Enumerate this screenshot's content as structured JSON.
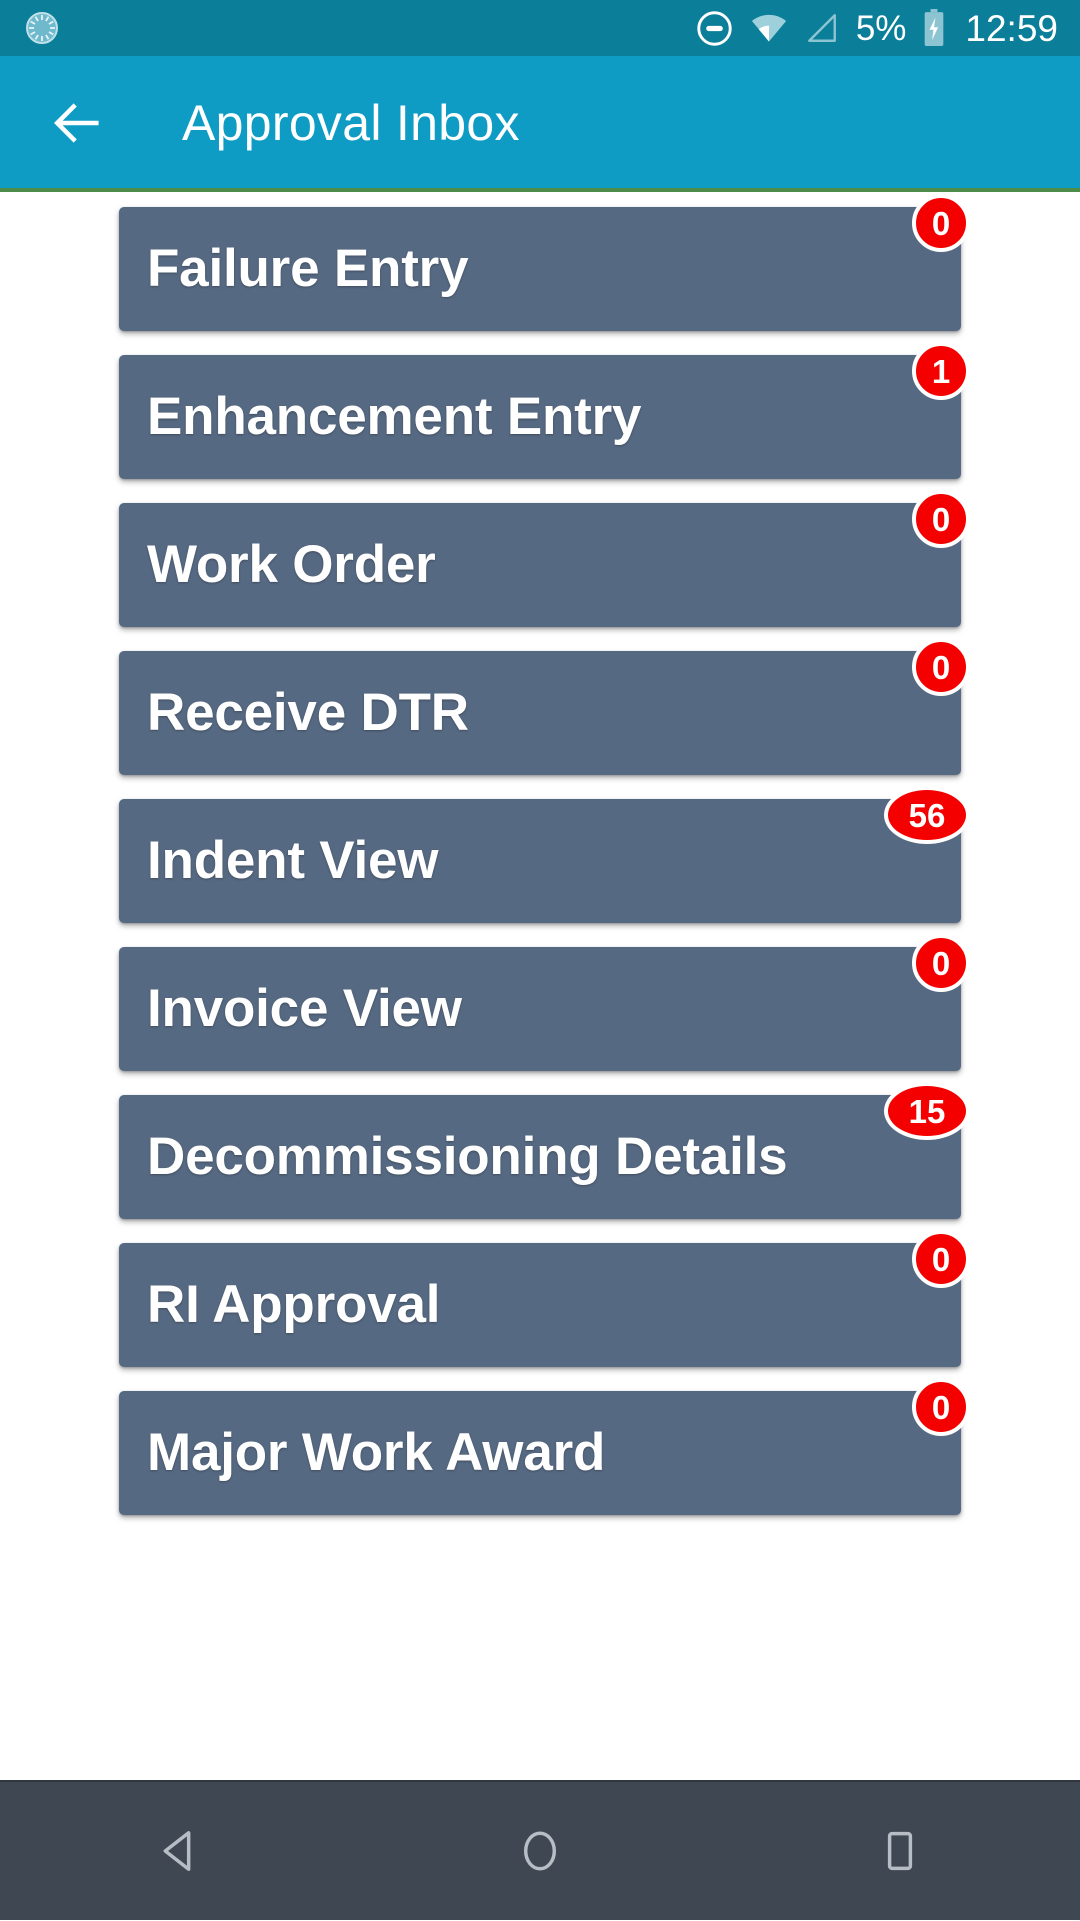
{
  "status_bar": {
    "app_icon": "sync-spinner-icon",
    "dnd_icon": "do-not-disturb-icon",
    "wifi_icon": "wifi-icon",
    "signal_icon": "cellular-signal-icon",
    "battery_percent": "5%",
    "battery_icon": "battery-charging-icon",
    "clock": "12:59",
    "background_color": "#0b7e99"
  },
  "app_bar": {
    "back_icon": "back-arrow-icon",
    "title": "Approval Inbox",
    "background_color": "#0e9cc4",
    "underline_color": "#4e8c4a"
  },
  "list": {
    "card_color": "#566982",
    "badge_color": "#f50000",
    "items": [
      {
        "label": "Failure Entry",
        "badge": "0"
      },
      {
        "label": "Enhancement Entry",
        "badge": "1"
      },
      {
        "label": "Work Order",
        "badge": "0"
      },
      {
        "label": "Receive DTR",
        "badge": "0"
      },
      {
        "label": "Indent View",
        "badge": "56"
      },
      {
        "label": "Invoice View",
        "badge": "0"
      },
      {
        "label": "Decommissioning Details",
        "badge": "15"
      },
      {
        "label": "RI Approval",
        "badge": "0"
      },
      {
        "label": "Major Work Award",
        "badge": "0"
      }
    ]
  },
  "nav_bar": {
    "background_color": "#3f4753",
    "buttons": [
      {
        "name": "back-nav-icon"
      },
      {
        "name": "home-nav-icon"
      },
      {
        "name": "recents-nav-icon"
      }
    ]
  }
}
